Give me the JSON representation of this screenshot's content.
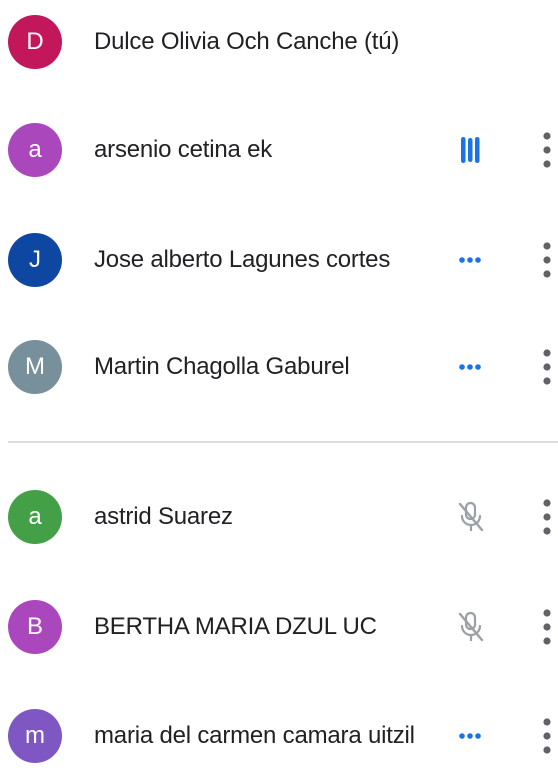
{
  "participants": [
    {
      "initial": "D",
      "name": "Dulce Olivia Och Canche (tú)",
      "avatar_color": "#c2185b",
      "status": "none",
      "status_icon": null,
      "has_menu": false
    },
    {
      "initial": "a",
      "name": "arsenio cetina ek",
      "avatar_color": "#ab47bc",
      "status": "speaking",
      "status_icon": "audio-bars-icon",
      "has_menu": true
    },
    {
      "initial": "J",
      "name": "Jose alberto Lagunes cortes",
      "avatar_color": "#0d47a1",
      "status": "unmuted",
      "status_icon": "three-dots-icon",
      "has_menu": true
    },
    {
      "initial": "M",
      "name": "Martin Chagolla Gaburel",
      "avatar_color": "#78909c",
      "status": "unmuted",
      "status_icon": "three-dots-icon",
      "has_menu": true
    },
    {
      "initial": "a",
      "name": "astrid Suarez",
      "avatar_color": "#43a047",
      "status": "muted",
      "status_icon": "mic-off-icon",
      "has_menu": true
    },
    {
      "initial": "B",
      "name": "BERTHA MARIA DZUL UC",
      "avatar_color": "#ab47bc",
      "status": "muted",
      "status_icon": "mic-off-icon",
      "has_menu": true
    },
    {
      "initial": "m",
      "name": "maria del carmen camara uitzil",
      "avatar_color": "#7e57c2",
      "status": "unmuted",
      "status_icon": "three-dots-icon",
      "has_menu": true
    }
  ],
  "colors": {
    "accent_blue": "#1a73e8",
    "muted_gray": "#9aa0a6",
    "menu_gray": "#5f6368",
    "divider": "#dadce0",
    "text": "#202124"
  }
}
